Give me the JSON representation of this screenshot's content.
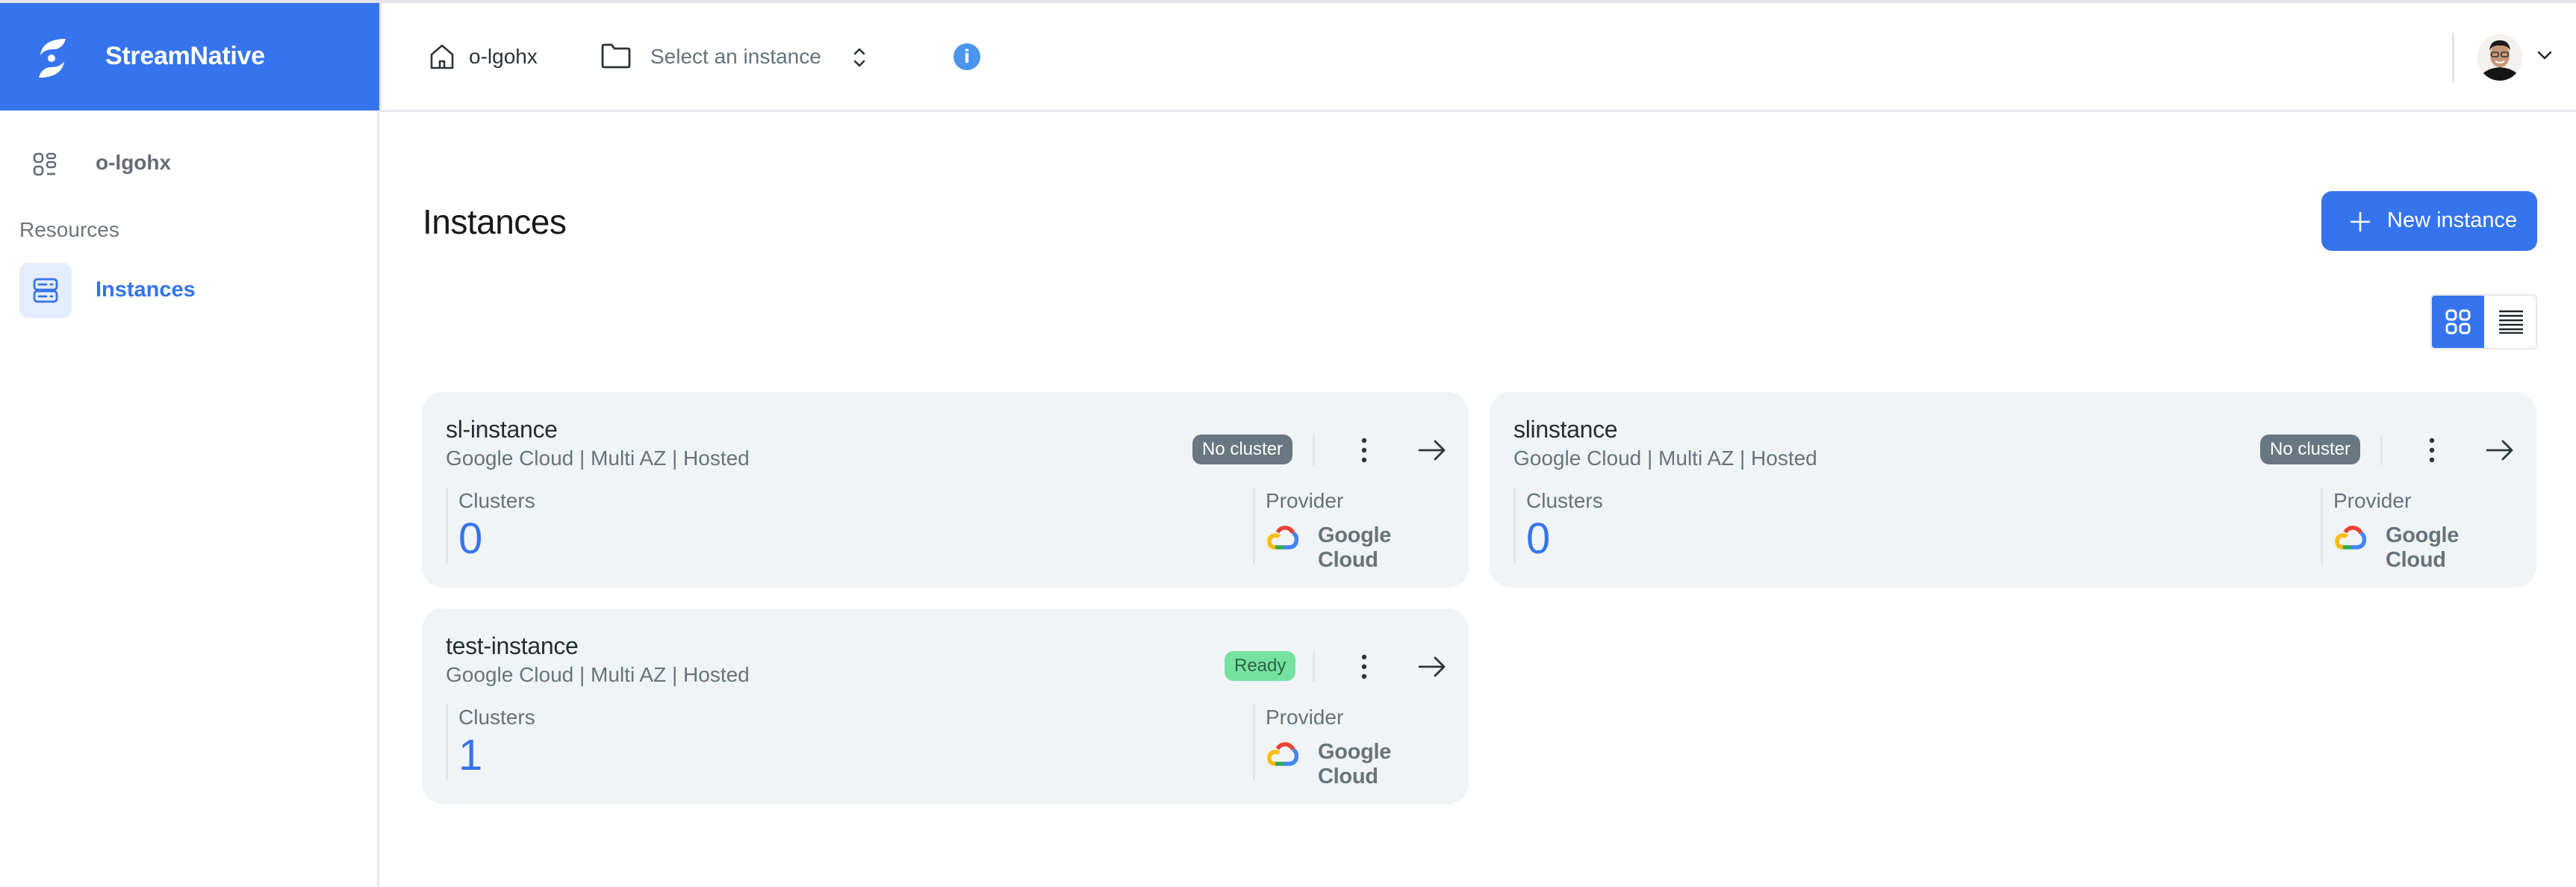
{
  "brand": {
    "name": "StreamNative",
    "color": "#3574ec"
  },
  "header": {
    "org_name": "o-lgohx",
    "instance_selector_placeholder": "Select an instance",
    "icons": {
      "home": "home-icon",
      "folder": "folder-icon",
      "selector": "chevron-up-down-icon",
      "info": "info-icon",
      "user_menu": "chevron-down-icon"
    },
    "info_glyph": "i"
  },
  "sidebar": {
    "org": {
      "label": "o-lgohx",
      "icon": "apps-grid-icon"
    },
    "section_label": "Resources",
    "items": [
      {
        "label": "Instances",
        "icon": "server-stack-icon",
        "active": true
      }
    ]
  },
  "main": {
    "title": "Instances",
    "new_button_label": "New instance",
    "view_modes": [
      {
        "name": "grid",
        "active": true
      },
      {
        "name": "list",
        "active": false
      }
    ],
    "cards": [
      {
        "name": "sl-instance",
        "subtitle": "Google Cloud | Multi AZ | Hosted",
        "status": "No cluster",
        "status_type": "nocluster",
        "clusters_label": "Clusters",
        "clusters_value": "0",
        "provider_label": "Provider",
        "provider_name": "Google Cloud"
      },
      {
        "name": "slinstance",
        "subtitle": "Google Cloud | Multi AZ | Hosted",
        "status": "No cluster",
        "status_type": "nocluster",
        "clusters_label": "Clusters",
        "clusters_value": "0",
        "provider_label": "Provider",
        "provider_name": "Google Cloud"
      },
      {
        "name": "test-instance",
        "subtitle": "Google Cloud | Multi AZ | Hosted",
        "status": "Ready",
        "status_type": "ready",
        "clusters_label": "Clusters",
        "clusters_value": "1",
        "provider_label": "Provider",
        "provider_name": "Google Cloud"
      }
    ]
  },
  "colors": {
    "accent": "#3574ec",
    "card_bg": "#f1f4f6",
    "badge_nocluster": "#687780",
    "badge_ready": "#76e2a0",
    "info": "#4a95ee"
  }
}
